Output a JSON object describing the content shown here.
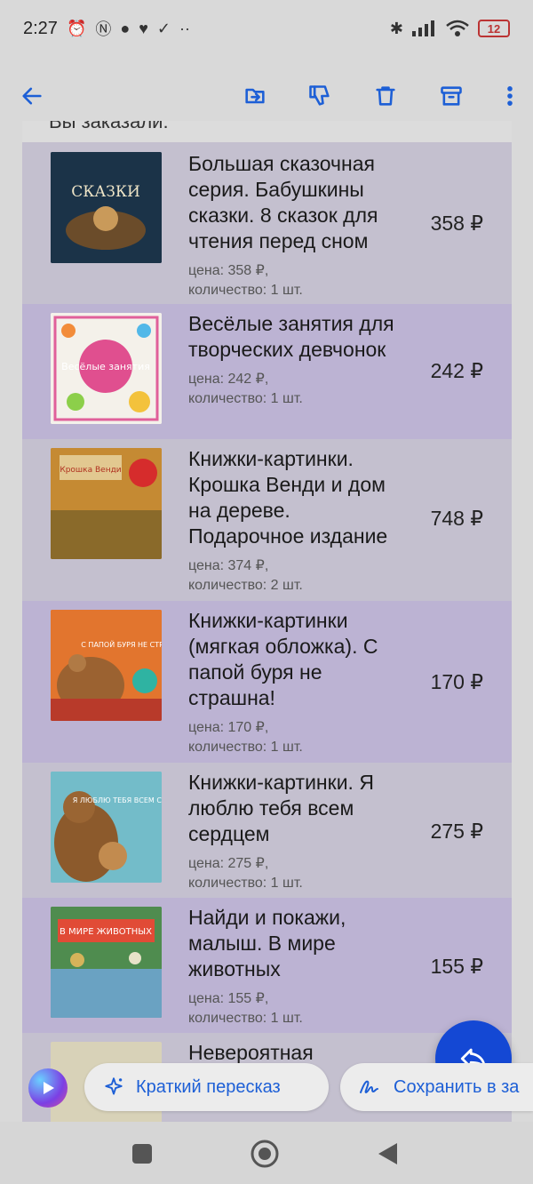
{
  "status_bar": {
    "time": "2:27",
    "battery": "12",
    "icons": [
      "alarm-icon",
      "nfc-icon",
      "chat-icon",
      "health-icon",
      "check-circle-icon",
      "more-dots-icon",
      "bluetooth-icon",
      "signal-icon",
      "wifi-icon",
      "battery-icon"
    ]
  },
  "toolbar": {
    "actions": [
      "back-icon",
      "move-icon",
      "dislike-icon",
      "delete-icon",
      "archive-icon",
      "more-vert-icon"
    ]
  },
  "email": {
    "clipped_heading": "Вы заказали:",
    "items": [
      {
        "title": "Большая сказочная серия. Бабушкины сказки. 8 сказок для чтения перед сном",
        "meta_price": "цена: 358 ₽,",
        "meta_qty": "количество: 1 шт.",
        "total": "358 ₽"
      },
      {
        "title": "Весёлые занятия для творческих девчонок",
        "meta_price": "цена: 242 ₽,",
        "meta_qty": "количество: 1 шт.",
        "total": "242 ₽"
      },
      {
        "title": "Книжки-картинки. Крошка Венди и дом на дереве. Подарочное издание",
        "meta_price": "цена: 374 ₽,",
        "meta_qty": "количество: 2 шт.",
        "total": "748 ₽"
      },
      {
        "title": "Книжки-картинки (мягкая обложка). С папой буря не страшна!",
        "meta_price": "цена: 170 ₽,",
        "meta_qty": "количество: 1 шт.",
        "total": "170 ₽"
      },
      {
        "title": "Книжки-картинки. Я люблю тебя всем сердцем",
        "meta_price": "цена: 275 ₽,",
        "meta_qty": "количество: 1 шт.",
        "total": "275 ₽"
      },
      {
        "title": "Найди и покажи, малыш. В мире животных",
        "meta_price": "цена: 155 ₽,",
        "meta_qty": "количество: 1 шт.",
        "total": "155 ₽"
      },
      {
        "title": "Невероятная",
        "meta_price": "",
        "meta_qty": "",
        "total": ""
      }
    ]
  },
  "cover_texts": {
    "c1": "СКАЗКИ",
    "c2": "Весёлые занятия",
    "c3": "Крошка Венди",
    "c4": "С ПАПОЙ БУРЯ НЕ СТРАШНА!",
    "c5": "Я ЛЮБЛЮ ТЕБЯ ВСЕМ СЕРДЦЕМ",
    "c6": "В МИРЕ ЖИВОТНЫХ"
  },
  "chips": {
    "summary": "Краткий пересказ",
    "save": "Сохранить в за"
  },
  "colors": {
    "accent": "#1d5fd6",
    "fab": "#1448d4"
  }
}
